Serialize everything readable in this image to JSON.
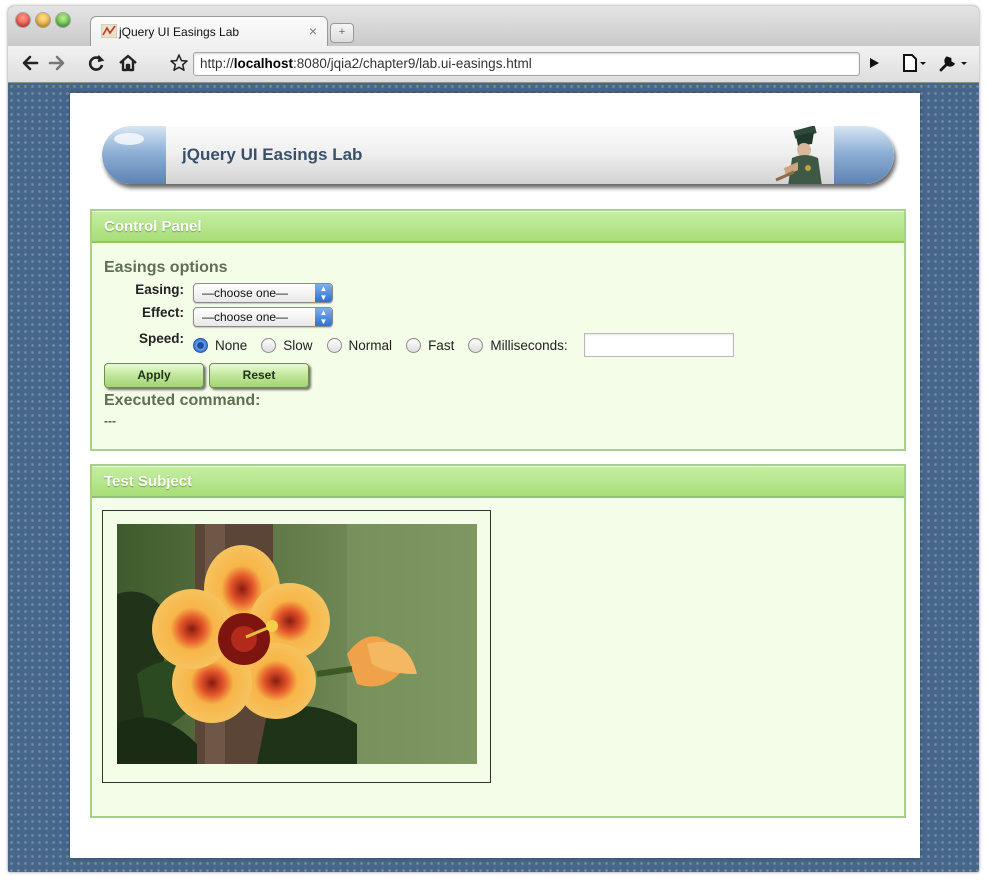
{
  "browser": {
    "tab_title": "jQuery UI Easings Lab",
    "tab_close": "×",
    "new_tab": "+",
    "url_prefix": "http://",
    "url_host": "localhost",
    "url_rest": ":8080/jqia2/chapter9/lab.ui-easings.html"
  },
  "banner": {
    "title": "jQuery UI Easings Lab"
  },
  "control_panel": {
    "title": "Control Panel",
    "section_title": "Easings options",
    "easing_label": "Easing:",
    "easing_value": "—choose one—",
    "effect_label": "Effect:",
    "effect_value": "—choose one—",
    "speed_label": "Speed:",
    "speed_options": [
      "None",
      "Slow",
      "Normal",
      "Fast",
      "Milliseconds:"
    ],
    "speed_selected": "None",
    "milliseconds_value": "",
    "apply_label": "Apply",
    "reset_label": "Reset",
    "executed_title": "Executed command:",
    "executed_value": "---"
  },
  "test_subject": {
    "title": "Test Subject"
  },
  "colors": {
    "panel_header": "#a8de78",
    "panel_bg": "#f4fde8",
    "page_bg": "#46678a"
  }
}
